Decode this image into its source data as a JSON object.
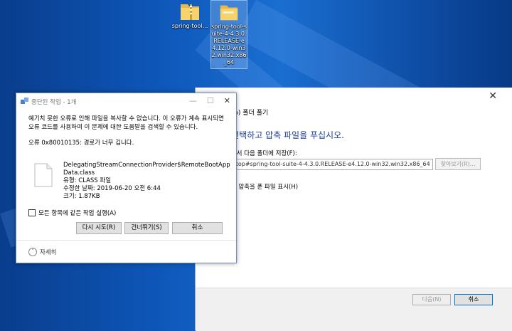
{
  "desktop": {
    "icons": [
      {
        "label": "spring-tool..."
      },
      {
        "label": "spring-tool-suite-4-4.3.0.RELEASE-e4.12.0-win32.win32.x86_64"
      }
    ]
  },
  "wizard": {
    "title": "(Zip) 폴더 풀기",
    "heading": "- 선택하고 압축 파일을 푸십시오.",
    "dest_label": "풀어서 다음 폴더에 저장(F):",
    "dest_path": "esktop#spring-tool-suite-4-4.3.0.RELEASE-e4.12.0-win32.win32.x86_64",
    "browse_label": "찾아보기(R)...",
    "show_files_label": "되면 압축을 푼 파일 표시(H)",
    "next_label": "다음(N)",
    "cancel_label": "취소"
  },
  "dialog": {
    "title": "중단된 작업 - 1개",
    "message": "예기치 못한 오류로 인해 파일을 복사할 수 없습니다. 이 오류가 계속 표시되면 오류 코드를 사용하여 이 문제에 대한 도움말을 검색할 수 있습니다.",
    "error": "오류 0x80010135: 경로가 너무 깁니다.",
    "file": {
      "name": "DelegatingStreamConnectionProvider$RemoteBootAppData.class",
      "type": "유형: CLASS 파일",
      "modified": "수정한 날짜: 2019-06-20 오전 6:44",
      "size": "크기: 1.87KB"
    },
    "apply_all_label": "모든 항목에 같은 작업 실행(A)",
    "retry_label": "다시 시도(R)",
    "skip_label": "건너뛰기(S)",
    "cancel_label": "취소",
    "details_label": "자세히"
  }
}
